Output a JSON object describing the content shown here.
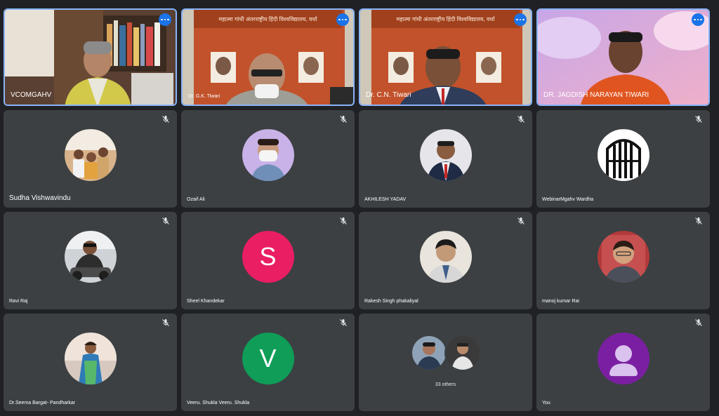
{
  "tiles": [
    {
      "name": "VCOMGAHV",
      "type": "video"
    },
    {
      "name": "Dr. G.K. Tiwari",
      "type": "video"
    },
    {
      "name": "Dr. C.N. Tiwari",
      "type": "video"
    },
    {
      "name": "DR. JAGDISH NARAYAN TIWARI",
      "type": "video"
    },
    {
      "name": "Sudha Vishwavindu",
      "type": "avatar"
    },
    {
      "name": "Ozaif Ali",
      "type": "avatar"
    },
    {
      "name": "AKHILESH YADAV",
      "type": "avatar"
    },
    {
      "name": "WebinarMgahv Wardha",
      "type": "avatar"
    },
    {
      "name": "Ravi Raj",
      "type": "avatar"
    },
    {
      "name": "Sheel Khandekar",
      "type": "letter",
      "letter": "S",
      "color": "#e91e63"
    },
    {
      "name": "Rakesh Singh phakaliyal",
      "type": "avatar"
    },
    {
      "name": "manoj kumar Rai",
      "type": "avatar"
    },
    {
      "name": "Dr.Seema Bargat- Pandharkar",
      "type": "avatar"
    },
    {
      "name": "Veeru. Shukla Veeru. Shukla",
      "type": "letter",
      "letter": "V",
      "color": "#0f9d58"
    },
    {
      "name": "33 others",
      "type": "others"
    },
    {
      "name": "You",
      "type": "you"
    }
  ],
  "banner_text": "महात्मा गांधी अंतरराष्ट्रीय हिंदी विश्वविद्यालय, वर्धा",
  "colors": {
    "bg": "#202124",
    "tile": "#3c4043",
    "active_border": "#8ab4f8",
    "more_button": "#1a73e8",
    "you_avatar": "#7b1fa2"
  }
}
